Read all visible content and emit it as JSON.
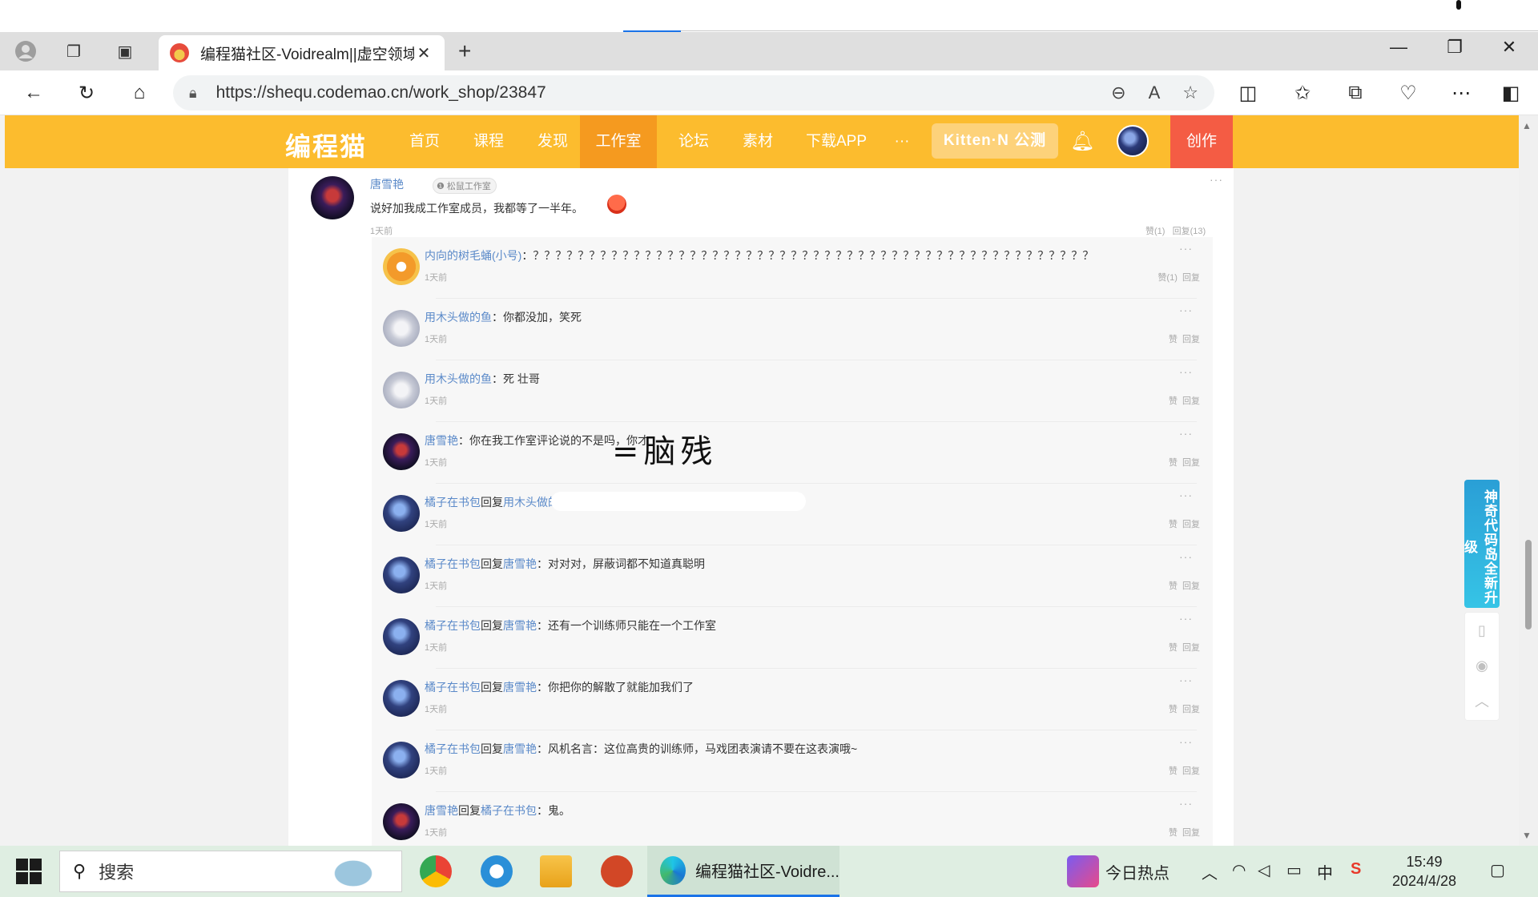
{
  "browser": {
    "tab_title": "编程猫社区-Voidrealm||虚空领域",
    "tab_close": "✕",
    "new_tab": "+",
    "url": "https://shequ.codemao.cn/work_shop/23847"
  },
  "site_nav": {
    "logo": "编程猫",
    "links": [
      "首页",
      "课程",
      "发现",
      "工作室",
      "论坛",
      "素材",
      "下载APP"
    ],
    "more": "···",
    "kitten": "Kitten·N 公测",
    "create": "创作"
  },
  "main_comment": {
    "author": "唐雪艳",
    "badge": "❶ 松鼠工作室",
    "text": "说好加我成工作室成员，我都等了一半年。",
    "time": "1天前",
    "like": "赞(1)",
    "reply": "回复(13)"
  },
  "replies": [
    {
      "author": "内向的树毛蛹(小号)",
      "reply_to": "",
      "text": "？？？？？？？？？？？？？？？？？？？？？？？？？？？？？？？？？？？？？？？？？？？？？？？？？？",
      "time": "1天前",
      "like": "赞(1)",
      "reply": "回复",
      "avatar": "tree"
    },
    {
      "author": "用木头做的鱼",
      "reply_to": "",
      "text": "你都没加，笑死",
      "time": "1天前",
      "like": "赞",
      "reply": "回复",
      "avatar": "fish"
    },
    {
      "author": "用木头做的鱼",
      "reply_to": "",
      "text": "死 壮哥",
      "time": "1天前",
      "like": "赞",
      "reply": "回复",
      "avatar": "fish"
    },
    {
      "author": "唐雪艳",
      "reply_to": "",
      "text": "你在我工作室评论说的不是吗，你才",
      "time": "1天前",
      "like": "赞",
      "reply": "回复",
      "avatar": "tang",
      "handwriting": "=脑残"
    },
    {
      "author": "橘子在书包",
      "reply_to": "用木头做的鱼",
      "text": "",
      "time": "1天前",
      "like": "赞",
      "reply": "回复",
      "avatar": "orange",
      "redacted": true
    },
    {
      "author": "橘子在书包",
      "reply_to": "唐雪艳",
      "text": "对对对，屏蔽词都不知道真聪明",
      "time": "1天前",
      "like": "赞",
      "reply": "回复",
      "avatar": "orange"
    },
    {
      "author": "橘子在书包",
      "reply_to": "唐雪艳",
      "text": "还有一个训练师只能在一个工作室",
      "time": "1天前",
      "like": "赞",
      "reply": "回复",
      "avatar": "orange"
    },
    {
      "author": "橘子在书包",
      "reply_to": "唐雪艳",
      "text": "你把你的解散了就能加我们了",
      "time": "1天前",
      "like": "赞",
      "reply": "回复",
      "avatar": "orange"
    },
    {
      "author": "橘子在书包",
      "reply_to": "唐雪艳",
      "text": "风机名言：这位高贵的训练师，马戏团表演请不要在这表演哦~",
      "time": "1天前",
      "like": "赞",
      "reply": "回复",
      "avatar": "orange"
    },
    {
      "author": "唐雪艳",
      "reply_to": "橘子在书包",
      "text": "鬼。",
      "time": "1天前",
      "like": "赞",
      "reply": "回复",
      "avatar": "tang"
    }
  ],
  "reply_word": "回复",
  "side_ad": "神奇代码岛全新升级",
  "taskbar": {
    "search": "搜索",
    "edge_label": "编程猫社区-Voidre...",
    "hot": "今日热点",
    "ime": "中",
    "time": "15:49",
    "date": "2024/4/28"
  }
}
